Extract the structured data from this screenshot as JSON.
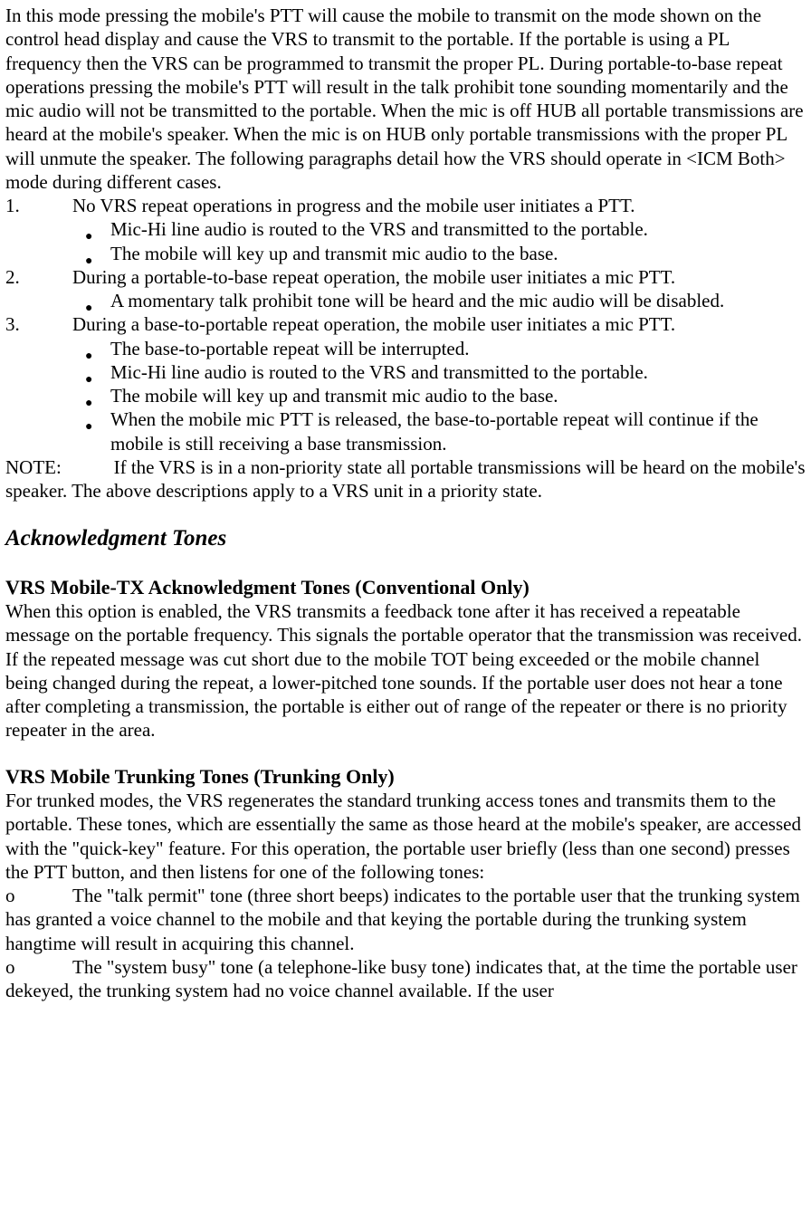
{
  "introPara": "In this mode pressing the mobile's PTT will cause the mobile to transmit on the mode shown on the control head display and cause the VRS to transmit to the portable. If the portable is using a PL frequency then the VRS can be programmed to transmit the proper PL. During portable-to-base repeat operations pressing the mobile's PTT will result in the talk prohibit tone sounding momentarily and the mic audio will not be transmitted to the portable. When the mic is off HUB all portable transmissions are heard at the mobile's speaker. When the mic is on HUB only portable transmissions with the proper PL will unmute the speaker.    The following paragraphs detail how the VRS should operate in <ICM Both> mode during different cases.",
  "case1": {
    "num": "1.",
    "text": "No VRS repeat operations in progress and the mobile user initiates a PTT.",
    "bullets": [
      "Mic-Hi line audio is routed to the VRS and transmitted to the portable.",
      "The mobile will key up and transmit mic audio to the base."
    ]
  },
  "case2": {
    "num": "2.",
    "text": "During a portable-to-base repeat operation, the mobile user initiates a mic PTT.",
    "bullets": [
      "A momentary talk prohibit tone will be heard and the mic audio will be disabled."
    ]
  },
  "case3": {
    "num": "3.",
    "text": "During a base-to-portable repeat operation, the mobile user initiates a mic PTT.",
    "bullets": [
      "The base-to-portable repeat will be interrupted.",
      "Mic-Hi line audio is routed to the VRS and transmitted to the portable.",
      "The mobile will key up and transmit mic audio to the base.",
      "When the mobile mic PTT is released, the base-to-portable repeat will continue if the mobile is still receiving a base transmission."
    ]
  },
  "note": {
    "label": "NOTE:",
    "text": "If the VRS is in a non-priority state all portable transmissions will be heard on the mobile's speaker. The above descriptions apply to a VRS unit in a priority state."
  },
  "ackHeading": "Acknowledgment Tones",
  "sectionA": {
    "heading": "VRS Mobile-TX Acknowledgment Tones (Conventional Only)",
    "body": "When this option is enabled, the VRS transmits a feedback tone after it has received a repeatable message on the portable frequency. This signals the portable operator that the transmission was received. If the repeated message was cut short due to the mobile TOT being exceeded or the mobile channel being changed during the repeat, a lower-pitched tone sounds. If the portable user does not hear a tone after completing a transmission, the portable is either out of range of the repeater or there is no priority repeater in the area."
  },
  "sectionB": {
    "heading": "VRS Mobile Trunking Tones (Trunking Only)",
    "body": "For trunked modes, the VRS regenerates the standard trunking access tones and transmits them to the portable. These tones, which are essentially the same as those heard at the mobile's speaker, are accessed with the \"quick-key\" feature. For this operation, the portable user briefly (less than one second) presses the PTT button, and then listens for one of the following tones:",
    "oItems": [
      "The \"talk permit\" tone (three short beeps) indicates to the portable user that the trunking system has granted a voice channel to the mobile and that keying the portable during the trunking system hangtime will result in acquiring this channel.",
      "The \"system busy\" tone (a telephone-like busy tone) indicates that, at the time the portable user dekeyed, the trunking system had no voice channel available. If the user"
    ],
    "oMarker": "o"
  }
}
